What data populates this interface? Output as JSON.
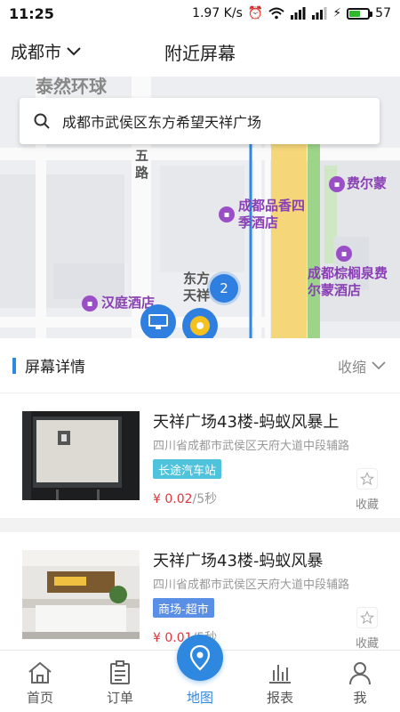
{
  "status_bar": {
    "time": "11:25",
    "speed": "1.97 K/s",
    "battery": "57",
    "battery_level": 0.57
  },
  "header": {
    "city": "成都市",
    "title": "附近屏幕"
  },
  "map": {
    "search_text": "成都市武侯区东方希望天祥广场",
    "labels": {
      "taiyan": "泰然环球",
      "wulu": "五路",
      "pinxiang": "成都品香四季酒店",
      "feierm": "费尔蒙",
      "zonglv": "成都棕榈泉费尔蒙酒店",
      "hanting": "汉庭酒店",
      "dongfang": "东方天祥"
    },
    "cluster_count": "2"
  },
  "section": {
    "title": "屏幕详情",
    "collapse": "收缩"
  },
  "screens": [
    {
      "name": "天祥广场43楼-蚂蚁风暴上",
      "address": "四川省成都市武侯区天府大道中段辅路",
      "tag": "长途汽车站",
      "tag_color": "#4fc3dc",
      "price": "¥ 0.02",
      "unit": "/5秒",
      "fav": "收藏"
    },
    {
      "name": "天祥广场43楼-蚂蚁风暴",
      "address": "四川省成都市武侯区天府大道中段辅路",
      "tag": "商场-超市",
      "tag_color": "#5a8fe6",
      "price": "¥ 0.01",
      "unit": "/5秒",
      "fav": "收藏"
    }
  ],
  "nav": {
    "home": "首页",
    "orders": "订单",
    "map": "地图",
    "reports": "报表",
    "me": "我"
  },
  "colors": {
    "accent": "#2f88e0",
    "price": "#e0353d",
    "poi": "#9a4fc6"
  }
}
